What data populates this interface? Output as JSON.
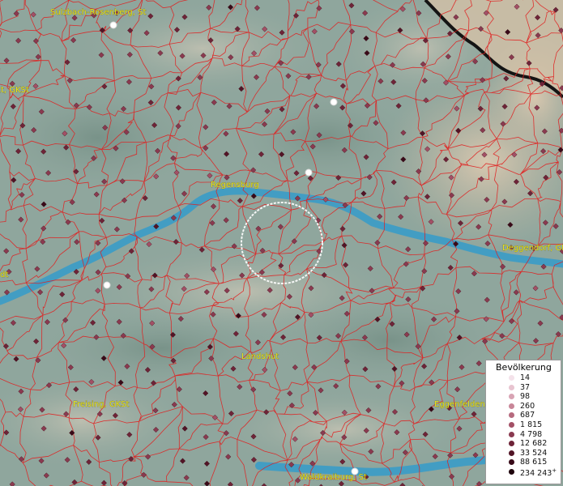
{
  "cities": [
    {
      "name": "Sulzbach-Rosenberg, St"
    },
    {
      "name": "Regensburg"
    },
    {
      "name": "Deggendorf, GK"
    },
    {
      "name": "dt"
    },
    {
      "name": "Rt, GKSt"
    },
    {
      "name": "Landshut"
    },
    {
      "name": "Freising, GKSt"
    },
    {
      "name": "Eggenfelden"
    },
    {
      "name": "Waldkraiburg, St"
    }
  ],
  "legend": {
    "title": "Bevölkerung",
    "entries": [
      {
        "label": "14",
        "color": "#f4e2ea"
      },
      {
        "label": "37",
        "color": "#e8c4d0"
      },
      {
        "label": "98",
        "color": "#d8a4b4"
      },
      {
        "label": "260",
        "color": "#c88698"
      },
      {
        "label": "687",
        "color": "#b66a7e"
      },
      {
        "label": "1 815",
        "color": "#a35066"
      },
      {
        "label": "4 798",
        "color": "#8a3a50"
      },
      {
        "label": "12 682",
        "color": "#6e2438"
      },
      {
        "label": "33 524",
        "color": "#521426"
      },
      {
        "label": "88 615",
        "color": "#380a18"
      },
      {
        "label": "234 243",
        "color": "#1e040c"
      }
    ],
    "overflow_mark": "+"
  },
  "colors": {
    "boundary": "#e02020",
    "river": "#3a9cc8",
    "terrain": "#8fa69d",
    "highland": "#c9b9a4",
    "border": "#141414"
  }
}
